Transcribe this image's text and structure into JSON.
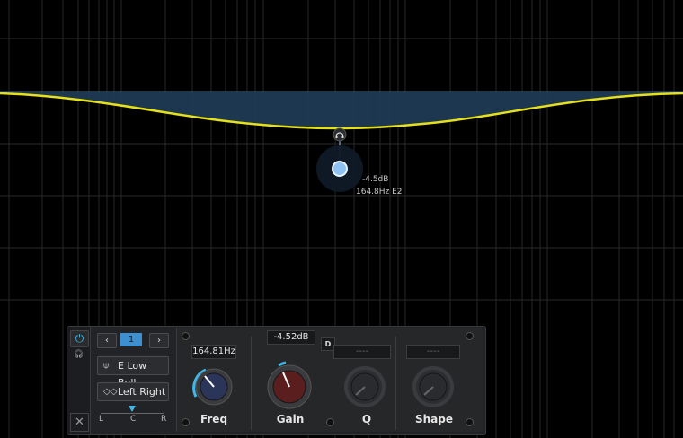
{
  "band": {
    "number": "1",
    "prev_icon": "chevron-left-icon",
    "next_icon": "chevron-right-icon",
    "filter_type": "E Low Bell",
    "filter_icon": "bell-filter-icon",
    "channel": "Left Right",
    "channel_icon": "stereo-link-icon"
  },
  "pan": {
    "left": "L",
    "center": "C",
    "right": "R"
  },
  "handle": {
    "gain_readout": "-4.5dB",
    "freq_readout": "164.8Hz E2"
  },
  "controls": {
    "freq": {
      "label": "Freq",
      "value": "164.81Hz"
    },
    "gain": {
      "label": "Gain",
      "value": "-4.52dB"
    },
    "q": {
      "label": "Q",
      "value": "----"
    },
    "shape": {
      "label": "Shape",
      "value": "----"
    },
    "dynamic_btn": "D"
  },
  "colors": {
    "accent": "#3fb7e9",
    "curve": "#e5e01a",
    "fill": "#1e3a53",
    "freq_knob": "#2b3559",
    "gain_knob": "#5a1e1e"
  }
}
